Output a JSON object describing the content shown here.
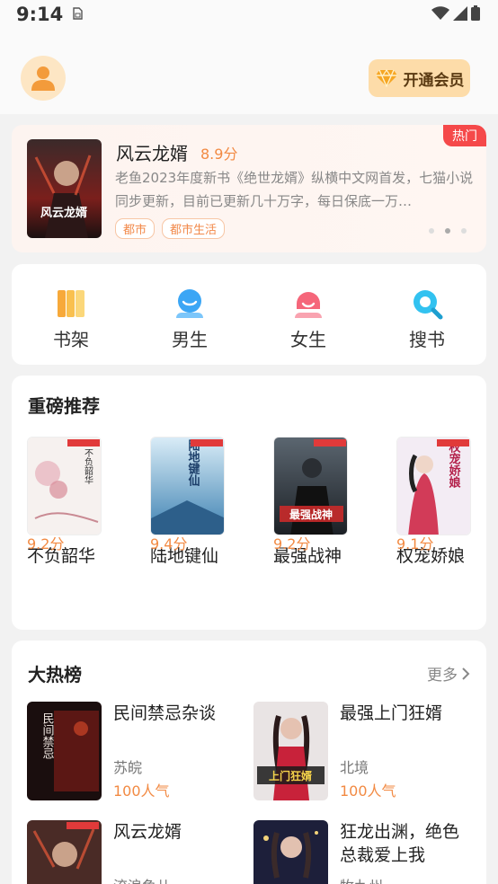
{
  "status_bar": {
    "time": "9:14"
  },
  "header": {
    "vip_label": "开通会员"
  },
  "banner": {
    "badge": "热门",
    "title": "风云龙婿",
    "score": "8.9分",
    "description": "老鱼2023年度新书《绝世龙婿》纵横中文网首发，七猫小说同步更新，目前已更新几十万字，每日保底一万…",
    "tags": [
      "都市",
      "都市生活"
    ],
    "cover_text": "风云龙婿"
  },
  "nav": {
    "items": [
      {
        "label": "书架",
        "icon": "bookshelf-icon"
      },
      {
        "label": "男生",
        "icon": "male-icon"
      },
      {
        "label": "女生",
        "icon": "female-icon"
      },
      {
        "label": "搜书",
        "icon": "search-book-icon"
      }
    ]
  },
  "recommend": {
    "title": "重磅推荐",
    "books": [
      {
        "name": "不负韶华",
        "score": "9.2分",
        "cover_text": "不负韶华"
      },
      {
        "name": "陆地键仙",
        "score": "9.4分",
        "cover_text": "陆地键仙"
      },
      {
        "name": "最强战神",
        "score": "9.2分",
        "cover_text": "最强战神"
      },
      {
        "name": "权宠娇娘",
        "score": "9.1分",
        "cover_text": "权宠娇娘"
      }
    ]
  },
  "ranking": {
    "title": "大热榜",
    "more_label": "更多",
    "books": [
      {
        "title": "民间禁忌杂谈",
        "author": "苏皖",
        "hot": "100人气",
        "cover_text": "民间禁忌"
      },
      {
        "title": "最强上门狂婿",
        "author": "北境",
        "hot": "100人气",
        "cover_text": "上门狂婿"
      },
      {
        "title": "风云龙婿",
        "author": "流浪鱼儿",
        "hot": "",
        "cover_text": ""
      },
      {
        "title": "狂龙出渊，绝色总裁爱上我",
        "author": "牧九州",
        "hot": "",
        "cover_text": ""
      }
    ]
  },
  "colors": {
    "accent": "#f28a43",
    "hot_badge": "#f5494a",
    "vip_bg": "#fddca9"
  }
}
